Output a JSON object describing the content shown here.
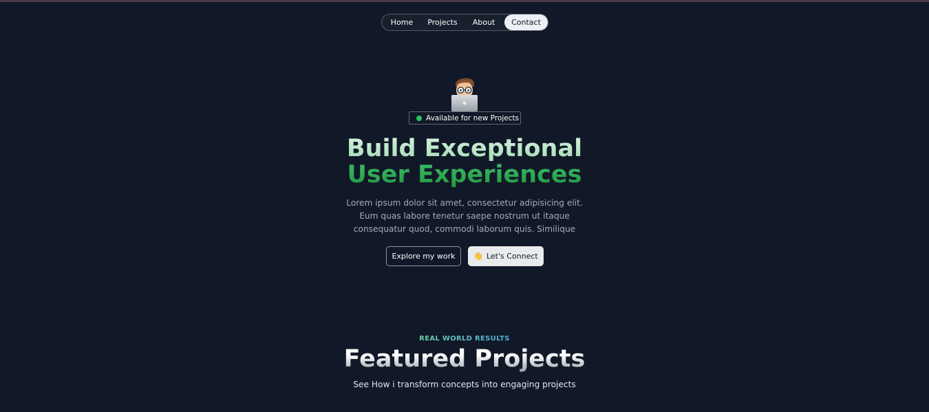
{
  "nav": {
    "items": [
      {
        "label": "Home"
      },
      {
        "label": "Projects"
      },
      {
        "label": "About"
      },
      {
        "label": "Contact"
      }
    ],
    "active": "Contact"
  },
  "hero": {
    "avatar_icon": "memoji-with-laptop-icon",
    "status_text": "Available for new Projects",
    "status_color": "#22c55e",
    "headline_line1": "Build Exceptional",
    "headline_line2": "User Experiences",
    "lead": "Lorem ipsum dolor sit amet, consectetur adipisicing elit. Eum quas labore tenetur saepe nostrum ut itaque consequatur quod, commodi laborum quis. Similique",
    "primary_button": "Explore my work",
    "secondary_button": "Let's Connect",
    "secondary_button_icon": "waving-hand-icon"
  },
  "featured": {
    "eyebrow": "REAL WORLD RESULTS",
    "title": "Featured Projects",
    "subtitle": "See How i transform concepts into engaging projects"
  },
  "colors": {
    "background": "#111827",
    "accent_green": "#2ea85a",
    "accent_light_green": "#bfe8cc",
    "eyebrow_teal": "#4fb6c6"
  }
}
